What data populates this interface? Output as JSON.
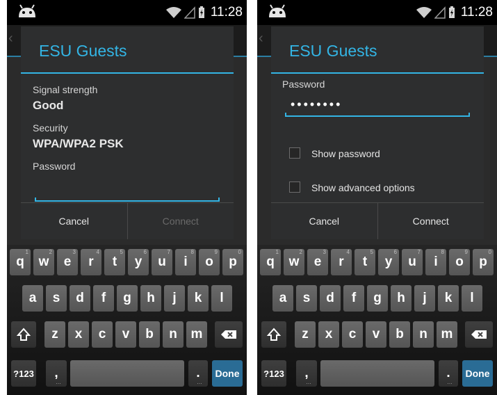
{
  "left": {
    "status": {
      "time": "11:28"
    },
    "dialog": {
      "title": "ESU Guests",
      "signal_label": "Signal strength",
      "signal_value": "Good",
      "security_label": "Security",
      "security_value": "WPA/WPA2 PSK",
      "password_label": "Password",
      "password_value": "",
      "cancel": "Cancel",
      "connect": "Connect"
    }
  },
  "right": {
    "status": {
      "time": "11:28"
    },
    "dialog": {
      "title": "ESU Guests",
      "password_label": "Password",
      "password_value": "••••••••",
      "show_password": "Show password",
      "show_advanced": "Show advanced options",
      "cancel": "Cancel",
      "connect": "Connect"
    }
  },
  "keyboard": {
    "row1": [
      {
        "k": "q",
        "n": "1"
      },
      {
        "k": "w",
        "n": "2"
      },
      {
        "k": "e",
        "n": "3"
      },
      {
        "k": "r",
        "n": "4"
      },
      {
        "k": "t",
        "n": "5"
      },
      {
        "k": "y",
        "n": "6"
      },
      {
        "k": "u",
        "n": "7"
      },
      {
        "k": "i",
        "n": "8"
      },
      {
        "k": "o",
        "n": "9"
      },
      {
        "k": "p",
        "n": "0"
      }
    ],
    "row2": [
      "a",
      "s",
      "d",
      "f",
      "g",
      "h",
      "j",
      "k",
      "l"
    ],
    "row3": [
      "z",
      "x",
      "c",
      "v",
      "b",
      "n",
      "m"
    ],
    "symbols": "?123",
    "comma": ",",
    "period": ".",
    "done": "Done"
  },
  "colors": {
    "accent": "#33b5e5",
    "done_key": "#2a6c95"
  }
}
